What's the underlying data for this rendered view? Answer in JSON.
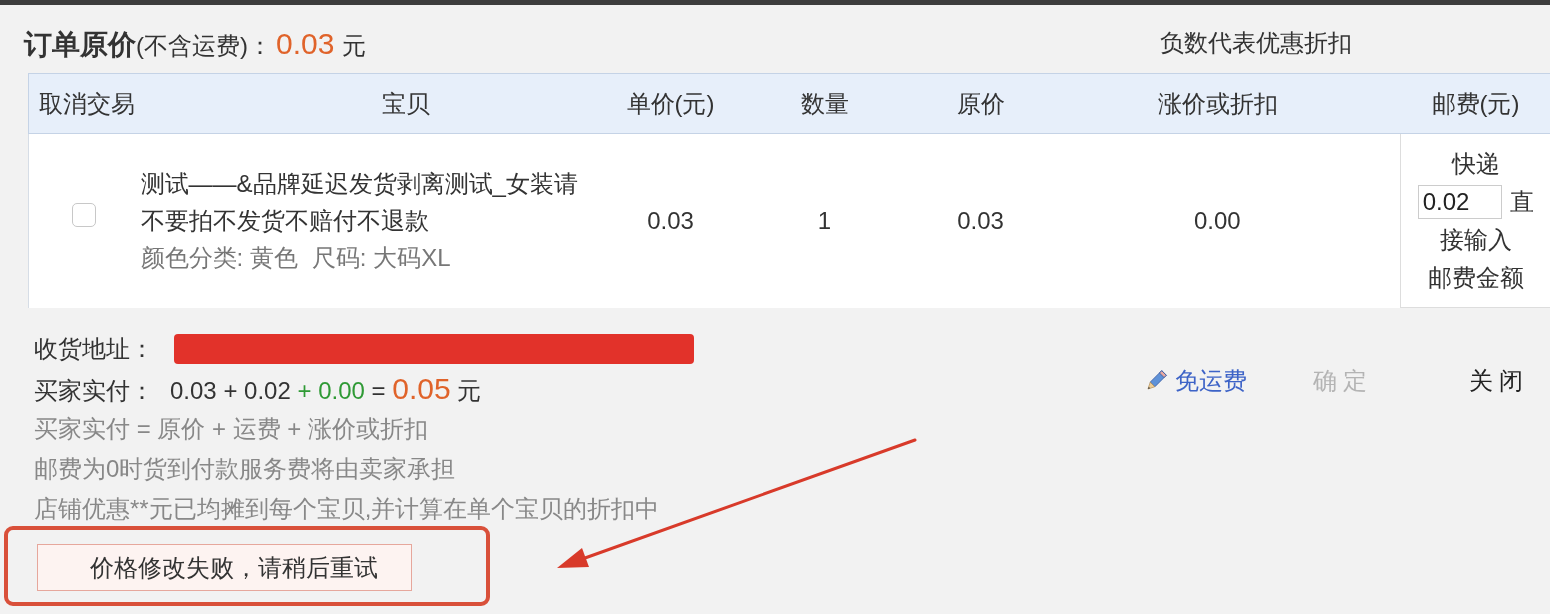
{
  "summary": {
    "label": "订单原价",
    "note": "(不含运费)：",
    "amount": "0.03",
    "unit": "元",
    "hint": "负数代表优惠折扣"
  },
  "table": {
    "columns": [
      "取消交易",
      "宝贝",
      "单价(元)",
      "数量",
      "原价",
      "涨价或折扣",
      "邮费(元)"
    ],
    "rows": [
      {
        "cancel_checked": false,
        "title": "测试——&品牌延迟发货剥离测试_女装请不要拍不发货不赔付不退款",
        "specs": [
          "颜色分类: 黄色",
          "尺码: 大码XL"
        ],
        "unit_price": "0.03",
        "quantity": "1",
        "original_price": "0.03",
        "adjustment": "0.00",
        "shipping": {
          "method": "快递",
          "value": "0.02",
          "hint_lines": [
            "直",
            "接输入",
            "邮费金额"
          ]
        }
      }
    ]
  },
  "address": {
    "label": "收货地址：",
    "redacted": true
  },
  "payment": {
    "label": "买家实付：",
    "formula": "0.03 + 0.02",
    "adjustment": "+ 0.00",
    "equals": "=",
    "total": "0.05",
    "unit": "元"
  },
  "notes": [
    "买家实付 = 原价 + 运费 + 涨价或折扣",
    "邮费为0时货到付款服务费将由卖家承担",
    "店铺优惠**元已均摊到每个宝贝,并计算在单个宝贝的折扣中"
  ],
  "actions": {
    "free_shipping": {
      "label": "免运费"
    },
    "confirm": {
      "label": "确 定",
      "disabled": true
    },
    "close": {
      "label": "关 闭",
      "disabled": false
    }
  },
  "error": {
    "message": "价格修改失败，请稍后重试",
    "framed": true,
    "arrow": true
  }
}
